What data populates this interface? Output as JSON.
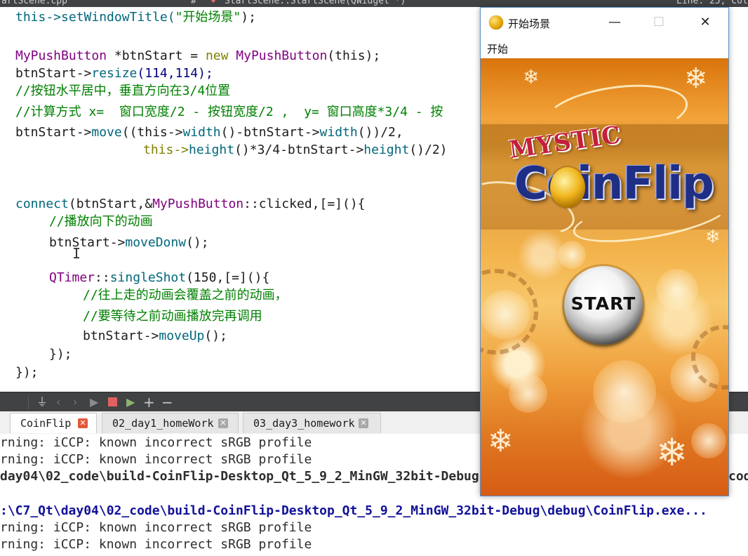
{
  "editor": {
    "header_file": "artScene.cpp",
    "header_hash": "#",
    "header_symbol": "StartScene::StartScene(QWidget *)",
    "header_position": "Line: 25, Col:",
    "code": {
      "l1_fn": "this->setWindowTitle(",
      "l1_str": "\"开始场景\"",
      "l1_end": ");",
      "l3_type": "MyPushButton",
      "l3_mid": " *btnStart = ",
      "l3_kw": "new",
      "l3_type2": " MyPushButton",
      "l3_end": "(this);",
      "l4_a": "btnStart->",
      "l4_fn": "resize",
      "l4_args": "(114,114);",
      "l5_comment": "//按钮水平居中，垂直方向在3/4位置",
      "l6_comment": "//计算方式 x=  窗口宽度/2 - 按钮宽度/2 ,  y= 窗口高度*3/4 - 按",
      "l7_a": "btnStart->",
      "l7_fn": "move",
      "l7_b": "((this->",
      "l7_fn2": "width",
      "l7_c": "()-btnStart->",
      "l7_fn3": "width",
      "l7_d": "())/2,",
      "l8_a": "this->",
      "l8_fn": "height",
      "l8_b": "()*3/4-btnStart->",
      "l8_fn2": "height",
      "l8_c": "()/2)",
      "l10_fn": "connect",
      "l10_a": "(btnStart,&",
      "l10_type": "MyPushButton",
      "l10_b": "::clicked,[=](){",
      "l11_comment": "//播放向下的动画",
      "l12_a": "btnStart->",
      "l12_fn": "moveDonw",
      "l12_b": "();",
      "l14_type": "QTimer",
      "l14_a": "::",
      "l14_fn": "singleShot",
      "l14_b": "(150,[=](){",
      "l15_comment": "//往上走的动画会覆盖之前的动画，",
      "l16_comment": "//要等待之前动画播放完再调用",
      "l17_a": "btnStart->",
      "l17_fn": "moveUp",
      "l17_b": "();",
      "l18": "});",
      "l19": "});"
    }
  },
  "toolbar": {
    "icons": [
      "filter-icon",
      "prev-icon",
      "next-icon",
      "run-icon",
      "stop-icon",
      "debug-run-icon",
      "plus-icon",
      "minus-icon"
    ],
    "plus": "+",
    "minus": "−"
  },
  "output_tabs": [
    {
      "label": "CoinFlip",
      "active": true
    },
    {
      "label": "02_day1_homeWork",
      "active": false
    },
    {
      "label": "03_day3_homework",
      "active": false
    }
  ],
  "output": {
    "line1": "rning: iCCP: known incorrect sRGB profile",
    "line2": "rning: iCCP: known incorrect sRGB profile",
    "line3": "day04\\02_code\\build-CoinFlip-Desktop_Qt_5_9_2_MinGW_32bit-Debug",
    "line3_tail": "cod",
    "line4": ":\\C7_Qt\\day04\\02_code\\build-CoinFlip-Desktop_Qt_5_9_2_MinGW_32bit-Debug\\debug\\CoinFlip.exe...",
    "line5": "rning: iCCP: known incorrect sRGB profile",
    "line6": "rning: iCCP: known incorrect sRGB profile"
  },
  "app_window": {
    "title": "开始场景",
    "menu": "开始",
    "buttons": {
      "minimize": "—",
      "maximize": "☐",
      "close": "✕"
    },
    "logo_mystic": "MYSTIC",
    "logo_coinflip": "CoinFlip",
    "start_label": "START"
  },
  "colors": {
    "window_border": "#5e8fc7",
    "active_tab_close": "#e05a3a",
    "editor_dark": "#404244"
  }
}
